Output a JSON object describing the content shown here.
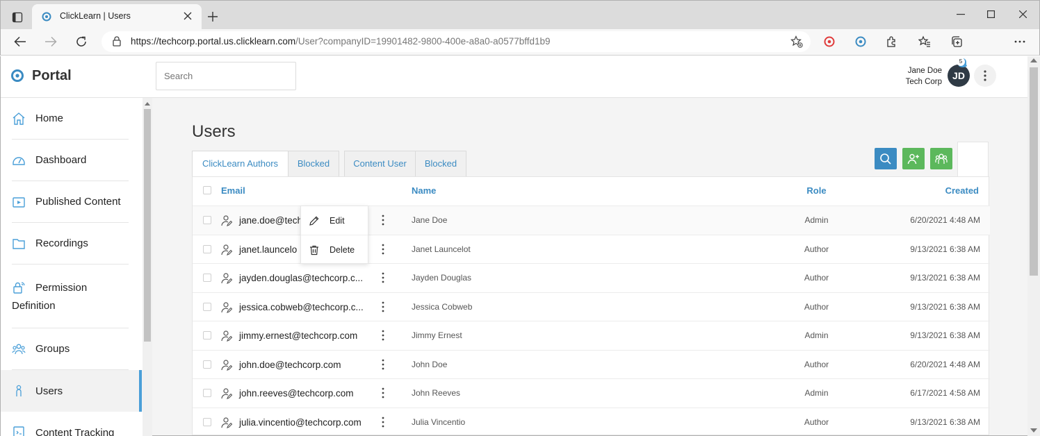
{
  "browser": {
    "tab_title": "ClickLearn | Users",
    "url_host": "https://techcorp.portal.us.clicklearn.com",
    "url_path": "/User?companyID=19901482-9800-400e-a8a0-a0577bffd1b9"
  },
  "app": {
    "brand": "Portal",
    "search_placeholder": "Search",
    "user": {
      "name": "Jane Doe",
      "company": "Tech Corp",
      "initials": "JD",
      "notifications": "5"
    }
  },
  "sidebar": {
    "items": [
      {
        "label": "Home",
        "icon": "home-icon"
      },
      {
        "label": "Dashboard",
        "icon": "dashboard-icon"
      },
      {
        "label": "Published Content",
        "icon": "play-icon"
      },
      {
        "label": "Recordings",
        "icon": "folder-icon"
      },
      {
        "label": "Permission",
        "label2": "Definition",
        "icon": "lock-icon"
      },
      {
        "label": "Groups",
        "icon": "groups-icon"
      },
      {
        "label": "Users",
        "icon": "user-icon",
        "active": true
      },
      {
        "label": "Content Tracking",
        "icon": "tracking-icon"
      }
    ]
  },
  "page": {
    "title": "Users",
    "tabs": [
      "ClickLearn Authors",
      "Blocked",
      "Content User",
      "Blocked"
    ],
    "columns": {
      "email": "Email",
      "name": "Name",
      "role": "Role",
      "created": "Created"
    },
    "rows": [
      {
        "email": "jane.doe@tech",
        "name": "Jane Doe",
        "role": "Admin",
        "created": "6/20/2021 4:48 AM"
      },
      {
        "email": "janet.launcelo",
        "name": "Janet Launcelot",
        "role": "Author",
        "created": "9/13/2021 6:38 AM"
      },
      {
        "email": "jayden.douglas@techcorp.c...",
        "name": "Jayden Douglas",
        "role": "Author",
        "created": "9/13/2021 6:38 AM"
      },
      {
        "email": "jessica.cobweb@techcorp.c...",
        "name": "Jessica Cobweb",
        "role": "Author",
        "created": "9/13/2021 6:38 AM"
      },
      {
        "email": "jimmy.ernest@techcorp.com",
        "name": "Jimmy Ernest",
        "role": "Admin",
        "created": "9/13/2021 6:38 AM"
      },
      {
        "email": "john.doe@techcorp.com",
        "name": "John Doe",
        "role": "Author",
        "created": "6/20/2021 4:48 AM"
      },
      {
        "email": "john.reeves@techcorp.com",
        "name": "John Reeves",
        "role": "Admin",
        "created": "6/17/2021 4:58 AM"
      },
      {
        "email": "julia.vincentio@techcorp.com",
        "name": "Julia Vincentio",
        "role": "Author",
        "created": "9/13/2021 6:38 AM"
      }
    ],
    "context_menu": {
      "edit": "Edit",
      "delete": "Delete"
    }
  },
  "colors": {
    "accent": "#3b8bc2",
    "search_btn": "#3b8bc2",
    "green_btn": "#5cb85c"
  }
}
